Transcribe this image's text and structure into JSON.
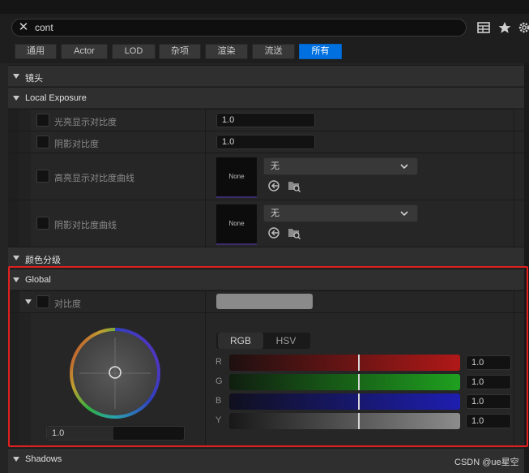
{
  "search": {
    "value": "cont"
  },
  "toolbar": {
    "icons": [
      "table-icon",
      "star-icon",
      "gear-icon"
    ]
  },
  "filters": [
    "通用",
    "Actor",
    "LOD",
    "杂项",
    "渲染",
    "流送",
    "所有"
  ],
  "filters_active": "所有",
  "sections": {
    "lens": "镜头",
    "local_exposure": "Local Exposure",
    "color_grading": "颜色分级",
    "global": "Global",
    "shadows": "Shadows"
  },
  "local_exposure": {
    "highlight_contrast": {
      "label": "光亮显示对比度",
      "value": "1.0"
    },
    "shadow_contrast": {
      "label": "阴影对比度",
      "value": "1.0"
    },
    "highlight_curve": {
      "label": "高亮显示对比度曲线",
      "thumb": "None",
      "dropdown": "无"
    },
    "shadow_curve": {
      "label": "阴影对比度曲线",
      "thumb": "None",
      "dropdown": "无"
    }
  },
  "global": {
    "contrast_label": "对比度",
    "wheel_value": "1.0",
    "tabs": {
      "rgb": "RGB",
      "hsv": "HSV",
      "active": "RGB"
    },
    "channels": [
      {
        "label": "R",
        "value": "1.0",
        "color": "#b01818"
      },
      {
        "label": "G",
        "value": "1.0",
        "color": "#1fa01f"
      },
      {
        "label": "B",
        "value": "1.0",
        "color": "#1e1eb0"
      },
      {
        "label": "Y",
        "value": "1.0",
        "color": "#8c8c8c"
      }
    ]
  },
  "colors": {
    "accent": "#0070e0",
    "highlight_box": "#e0201f"
  },
  "watermark": "CSDN @ue星空"
}
